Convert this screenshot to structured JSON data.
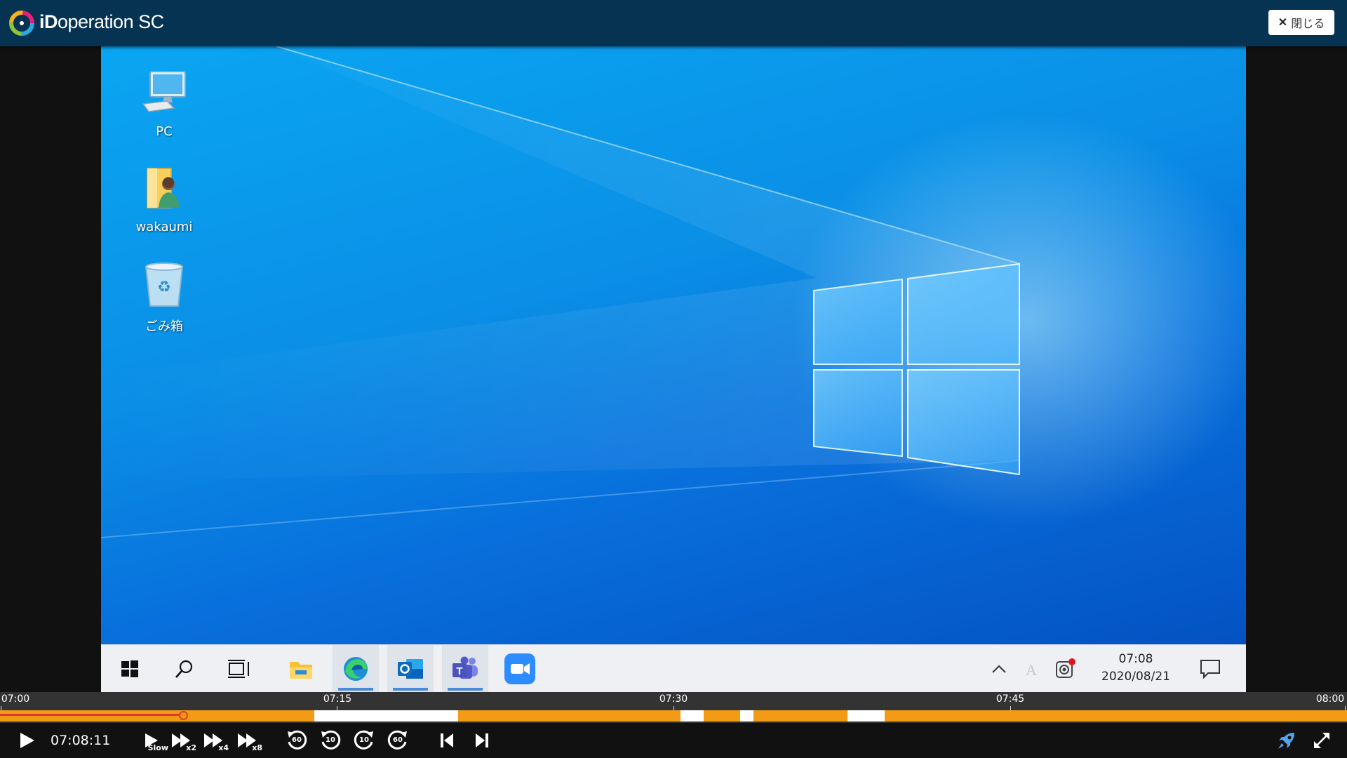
{
  "app": {
    "brand_prefix": "iD",
    "brand_suffix": "operation SC",
    "close_label": "閉じる"
  },
  "desktop": {
    "icons": [
      {
        "label": "PC",
        "icon": "computer-icon"
      },
      {
        "label": "wakaumi",
        "icon": "user-folder-icon"
      },
      {
        "label": "ごみ箱",
        "icon": "recycle-bin-icon"
      }
    ]
  },
  "taskbar": {
    "items": [
      "start",
      "search",
      "task-view",
      "file-explorer",
      "edge",
      "outlook",
      "teams",
      "zoom"
    ],
    "tray": {
      "time": "07:08",
      "date": "2020/08/21"
    }
  },
  "timeline": {
    "ticks": [
      "07:00",
      "07:15",
      "07:30",
      "07:45",
      "08:00"
    ],
    "current_fraction": 0.136
  },
  "player": {
    "current_time": "07:08:11",
    "slow_label": "Slow",
    "speed_labels": [
      "x2",
      "x4",
      "x8"
    ],
    "rewind_labels": [
      "60",
      "10"
    ],
    "forward_labels": [
      "10",
      "60"
    ]
  },
  "colors": {
    "appbar": "#063352",
    "timeline_recorded": "#f39a17",
    "timeline_gap": "#ffffff",
    "progress": "#e23b2e",
    "accent": "#4a8ad6"
  }
}
